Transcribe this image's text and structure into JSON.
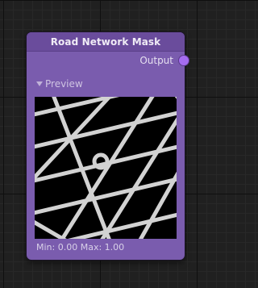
{
  "node": {
    "title": "Road Network Mask",
    "output_label": "Output",
    "preview_label": "Preview",
    "stats": "Min: 0.00 Max: 1.00"
  },
  "colors": {
    "node_body": "#7a5cae",
    "node_header": "#6a4c9c",
    "output_port": "#a56cf0",
    "road": "#d2d2d2",
    "mask_background": "#000000"
  },
  "icons": {
    "output_port": "output-port-icon",
    "preview_toggle": "triangle-down-icon"
  }
}
